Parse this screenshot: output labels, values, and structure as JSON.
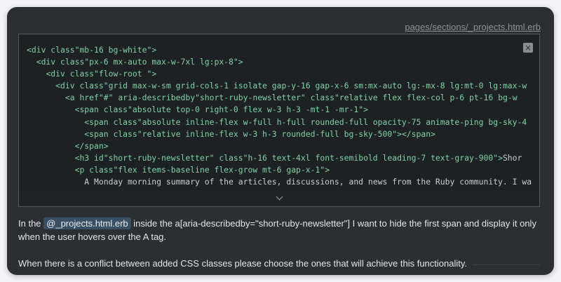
{
  "file_link": "pages/sections/_projects.html.erb",
  "code_lines": [
    "<div class=\"mb-16 bg-white\">",
    "  <div class=\"px-6 mx-auto max-w-7xl lg:px-8\">",
    "    <div class=\"flow-root \">",
    "      <div class=\"grid max-w-sm grid-cols-1 isolate gap-y-16 gap-x-6 sm:mx-auto lg:-mx-8 lg:mt-0 lg:max-w",
    "        <a href=\"#\" aria-describedby=\"short-ruby-newsletter\" class=\"relative flex flex-col p-6 pt-16 bg-w",
    "          <span class=\"absolute top-0 right-0 flex w-3 h-3 -mt-1 -mr-1\">",
    "            <span class=\"absolute inline-flex w-full h-full rounded-full opacity-75 animate-ping bg-sky-4",
    "            <span class=\"relative inline-flex w-3 h-3 rounded-full bg-sky-500\"></span>",
    "          </span>",
    "          <h3 id=\"short-ruby-newsletter\" class=\"h-16 text-4xl font-semibold leading-7 text-gray-900\">Shor",
    "          <p class=\"flex items-baseline flex-grow mt-6 gap-x-1\">",
    "            A Monday morning summary of the articles, discussions, and news from the Ruby community. I wa",
    "          </p>"
  ],
  "highlight_text": "aria-describedby=\"short-ruby-newsletter\"",
  "close_symbol": "×",
  "message": {
    "part1": "In the ",
    "chip": "@_projects.html.erb",
    "part2": " inside the a[aria-describedby=\"short-ruby-newsletter\"] I want to hide the first span and display it only when the user hovers over the A tag.",
    "paragraph2": "When there is a conflict between added CSS classes please choose the ones that will achieve this functionality."
  },
  "colors": {
    "panel_bg": "#2b2f33",
    "code_bg": "#1e2124",
    "code_green": "#7fd1a6",
    "chip_bg": "#3a4f63"
  },
  "icons": {
    "close": "close-icon",
    "expand": "chevron-down-icon"
  }
}
